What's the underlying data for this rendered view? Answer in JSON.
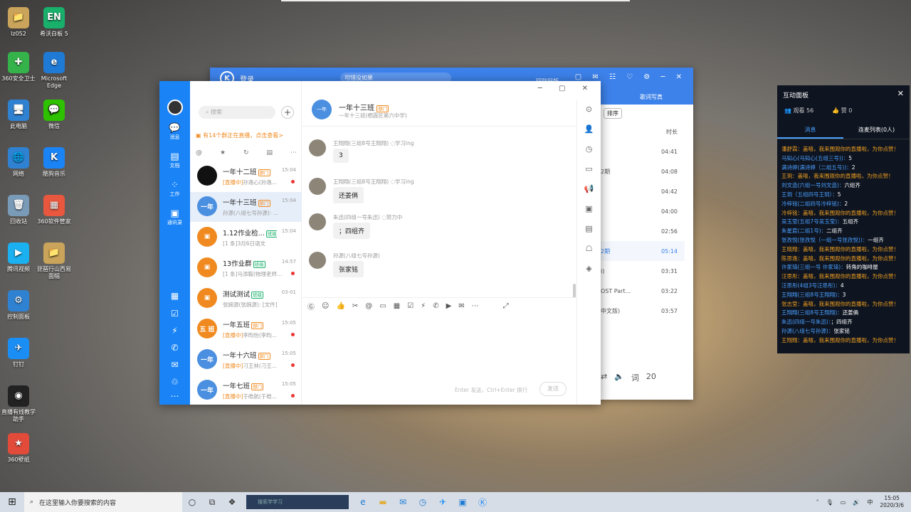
{
  "desktop_icons": [
    {
      "label": "lz052",
      "color": "#c9a45a",
      "glyph": "📁"
    },
    {
      "label": "希沃白板 5",
      "color": "#19b06c",
      "glyph": "EN"
    },
    {
      "label": "360安全卫士",
      "color": "#35b34a",
      "glyph": "✚"
    },
    {
      "label": "Microsoft Edge",
      "color": "#1f7ad6",
      "glyph": "e"
    },
    {
      "label": "此电脑",
      "color": "#2f82d2",
      "glyph": "🖥"
    },
    {
      "label": "微信",
      "color": "#2dc100",
      "glyph": "💬"
    },
    {
      "label": "网络",
      "color": "#2f82d2",
      "glyph": "🌐"
    },
    {
      "label": "酷狗音乐",
      "color": "#1a84f7",
      "glyph": "K"
    },
    {
      "label": "回收站",
      "color": "#7a9bb8",
      "glyph": "🗑"
    },
    {
      "label": "360软件管家",
      "color": "#e8573e",
      "glyph": "▦"
    },
    {
      "label": "腾讯视频",
      "color": "#1bb0f0",
      "glyph": "▶"
    },
    {
      "label": "琵琶行山西易面幅",
      "color": "#c9a45a",
      "glyph": "📁"
    },
    {
      "label": "控制面板",
      "color": "#2f82d2",
      "glyph": "⚙"
    },
    {
      "label": "钉钉",
      "color": "#1b8ef5",
      "glyph": "✈"
    },
    {
      "label": "直播有线教学助手",
      "color": "#222",
      "glyph": "◉"
    },
    {
      "label": "360壁纸",
      "color": "#e24a3a",
      "glyph": "★"
    }
  ],
  "music_window": {
    "title": "登录",
    "search_placeholder": "可惜没如果",
    "back_old": "回到旧版",
    "sub_action": "歌词写真",
    "sort_label": "排序",
    "col_duration": "时长",
    "rows": [
      {
        "title": "",
        "time": "04:41"
      },
      {
        "title": "2期",
        "time": "04:08"
      },
      {
        "title": "",
        "time": "04:42"
      },
      {
        "title": "",
        "time": "04:00"
      },
      {
        "title": "",
        "time": "02:56"
      },
      {
        "title": "2期",
        "time": "05:14"
      },
      {
        "title": "i)",
        "time": "03:31"
      },
      {
        "title": "OST Part...",
        "time": "03:22"
      },
      {
        "title": "中文版)",
        "time": "03:57"
      }
    ],
    "footer_count": "20"
  },
  "im": {
    "nav": {
      "messages": "消息",
      "docs": "文档",
      "work": "工作",
      "contacts": "通讯录"
    },
    "search_placeholder": "搜索",
    "live_notice": "有14个群正在直播，点击查看>",
    "conversations": [
      {
        "name": "一年十二班",
        "tag": "部门",
        "time": "15:04",
        "preview_live": "[直播中]",
        "preview": "孙逸心(孙逸...",
        "avatar_color": "#111",
        "avatar_text": "",
        "active": false,
        "dot": true
      },
      {
        "name": "一年十三班",
        "tag": "部门",
        "time": "15:04",
        "preview_live": "",
        "preview": "孙源(八组七号孙源): ...",
        "avatar_color": "#4a8fe0",
        "avatar_text": "一年",
        "active": true,
        "dot": false
      },
      {
        "name": "1.12作业检...",
        "tag": "班级",
        "time": "15:04",
        "preview_live": "",
        "preview": "[1 条]3月6日语文",
        "avatar_color": "#f08a20",
        "avatar_text": "▣",
        "active": false,
        "dot": false
      },
      {
        "name": "13作业群",
        "tag": "班级",
        "time": "14:57",
        "preview_live": "",
        "preview": "[1 条]马添鞍(物理老师...",
        "avatar_color": "#f08a20",
        "avatar_text": "▣",
        "active": false,
        "dot": true
      },
      {
        "name": "测试测试",
        "tag": "班级",
        "time": "03-01",
        "preview_live": "",
        "preview": "张婉源(张婉源): [文件]",
        "avatar_color": "#f08a20",
        "avatar_text": "▣",
        "active": false,
        "dot": false
      },
      {
        "name": "一年五班",
        "tag": "部门",
        "time": "15:05",
        "preview_live": "[直播中]",
        "preview": "李昀怡(李昀...",
        "avatar_color": "#f08a20",
        "avatar_text": "五 班",
        "active": false,
        "dot": true
      },
      {
        "name": "一年十六班",
        "tag": "部门",
        "time": "15:05",
        "preview_live": "[直播中]",
        "preview": "刁王林(刁王...",
        "avatar_color": "#4a8fe0",
        "avatar_text": "一年",
        "active": false,
        "dot": true
      },
      {
        "name": "一年七班",
        "tag": "部门",
        "time": "15:05",
        "preview_live": "[直播中]",
        "preview": "于皓航(于皓...",
        "avatar_color": "#4a8fe0",
        "avatar_text": "一年",
        "active": false,
        "dot": true
      }
    ],
    "chat": {
      "title": "一年十三班",
      "title_tag": "部门",
      "subtitle": "一年十三班(栖霞区第六中学)",
      "messages": [
        {
          "sender": "王翔翔(三组8号王翔翔)",
          "status": "学习ing",
          "text": "3"
        },
        {
          "sender": "王翔翔(三组8号王翔翔)",
          "status": "学习ing",
          "text": "还姜俩"
        },
        {
          "sender": "朱迅(四组一号朱迅)",
          "status": "努力中",
          "text": "；四组齐"
        },
        {
          "sender": "孙源(八组七号孙源)",
          "status": "",
          "text": "张家铭"
        }
      ],
      "input_hint": "Enter 发送，Ctrl+Enter 换行",
      "send_label": "发送"
    }
  },
  "panel": {
    "title": "互动面板",
    "viewers": "观看 56",
    "likes": "赞 0",
    "tab_messages": "消息",
    "tab_mic": "连麦列表(0人)",
    "lines": [
      {
        "name": "潘舒霖：",
        "text": "盖嘻，我来围观你的直播啦，为你点赞！",
        "sys": true
      },
      {
        "name": "马知心(马知心(五组三号))：",
        "text": "5",
        "sys": false
      },
      {
        "name": "满诗婷(满诗婷（二组五号))：",
        "text": "2",
        "sys": false
      },
      {
        "name": "王玥：",
        "text": "盖嘻，我来围观你的直播啦，为你点赞！",
        "sys": true
      },
      {
        "name": "刘文造(六组一号刘文造)：",
        "text": "六组齐",
        "sys": false
      },
      {
        "name": "王玥（五组四号王玥）：",
        "text": "5",
        "sys": false
      },
      {
        "name": "冷梓铭(二组四号冷梓铭)：",
        "text": "2",
        "sys": false
      },
      {
        "name": "冷梓铭：",
        "text": "盖嘻，我来围观你的直播啦，为你点赞！",
        "sys": true
      },
      {
        "name": "吴玉莹(五组7号吴玉莹)：",
        "text": "五组齐",
        "sys": false
      },
      {
        "name": "朱星宸(二组1号)：",
        "text": "二组齐",
        "sys": false
      },
      {
        "name": "张孜悦(张孜悦（一组一号张孜悦))：",
        "text": "一组齐",
        "sys": false
      },
      {
        "name": "王晓翔：",
        "text": "盖嘻，我来围观你的直播啦，为你点赞！",
        "sys": true
      },
      {
        "name": "陈思逸：",
        "text": "盖嘻，我来围观你的直播啦，为你点赞！",
        "sys": true
      },
      {
        "name": "许家琦(三组一号 许家琦)：",
        "text": "转角的咖啡屋",
        "sys": false
      },
      {
        "name": "汪思彤：",
        "text": "盖嘻，我来围观你的直播啦，为你点赞！",
        "sys": true
      },
      {
        "name": "汪思彤(4组3号汪思彤)：",
        "text": "4",
        "sys": false
      },
      {
        "name": "王翔翔(三组8号王翔翔)：",
        "text": "3",
        "sys": false
      },
      {
        "name": "张志莹：",
        "text": "盖嘻，我来围观你的直播啦，为你点赞！",
        "sys": true
      },
      {
        "name": "王翔翔(三组8号王翔翔)：",
        "text": "还姜俩",
        "sys": false
      },
      {
        "name": "朱迅(四组一号朱迅)：",
        "text": "；四组齐",
        "sys": false
      },
      {
        "name": "孙源(八组七号孙源)：",
        "text": "张家铭",
        "sys": false
      },
      {
        "name": "王翔翔：",
        "text": "盖嘻，我来围观你的直播啦，为你点赞！",
        "sys": true
      }
    ]
  },
  "taskbar": {
    "search_placeholder": "在这里输入你要搜索的内容",
    "box_text": "搜索学学习",
    "lang": "中",
    "time": "15:05",
    "date": "2020/3/6"
  }
}
